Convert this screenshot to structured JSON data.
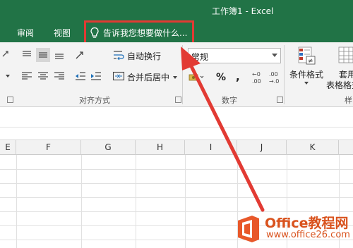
{
  "window": {
    "title": "工作簿1 - Excel"
  },
  "tabs": {
    "review": "审阅",
    "view": "视图"
  },
  "tell_me": {
    "text": "告诉我您想要做什么..."
  },
  "ribbon": {
    "wrap_text": "自动换行",
    "merge_center": "合并后居中",
    "number_format": "常规",
    "percent": "%",
    "comma": ",",
    "increase_decimal": "←0\n.00",
    "decrease_decimal": ".00\n→.0",
    "conditional_format": "条件格式",
    "table_format_line1": "套用",
    "table_format_line2": "表格格式",
    "alignment_group": "对齐方式",
    "number_group": "数字",
    "styles_group_partial": "样"
  },
  "columns": [
    "E",
    "F",
    "G",
    "H",
    "I",
    "J",
    "K"
  ],
  "watermark": {
    "brand": "Office教程网",
    "site": "www.office26.com"
  },
  "colors": {
    "excel_green": "#217346",
    "highlight_red": "#e23a33",
    "watermark_orange": "#d9531e"
  }
}
